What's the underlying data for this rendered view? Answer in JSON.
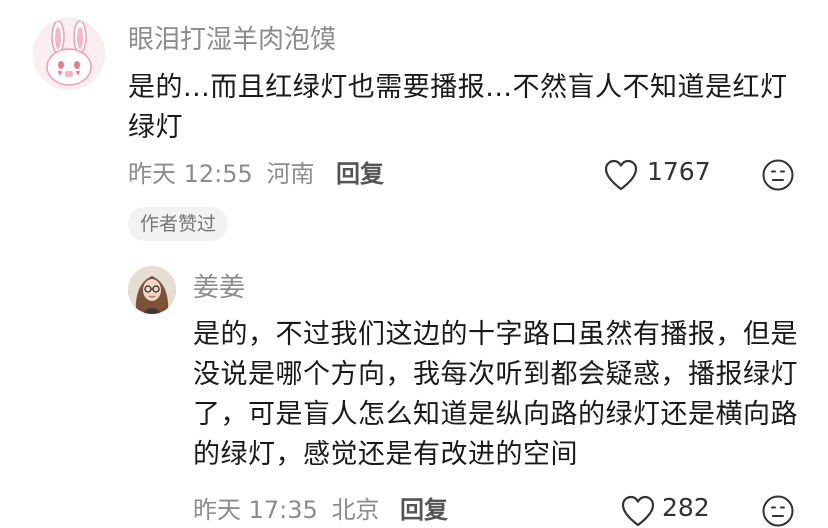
{
  "comment": {
    "username": "眼泪打湿羊肉泡馍",
    "text": "是的...而且红绿灯也需要播报...不然盲人不知道是红灯绿灯",
    "time": "昨天 12:55",
    "location": "河南",
    "reply_label": "回复",
    "likes": "1767",
    "badge": "作者赞过",
    "avatar_icon": "rabbit-avatar-icon"
  },
  "reply": {
    "username": "姜姜",
    "text": "是的，不过我们这边的十字路口虽然有播报，但是没说是哪个方向，我每次听到都会疑惑，播报绿灯了，可是盲人怎么知道是纵向路的绿灯还是横向路的绿灯，感觉还是有改进的空间",
    "time": "昨天 17:35",
    "location": "北京",
    "reply_label": "回复",
    "likes": "282",
    "avatar_icon": "user-photo-avatar"
  },
  "colors": {
    "meta_gray": "#8c8c8c",
    "badge_bg": "#f2f2f2",
    "text": "#1a1a1a"
  }
}
